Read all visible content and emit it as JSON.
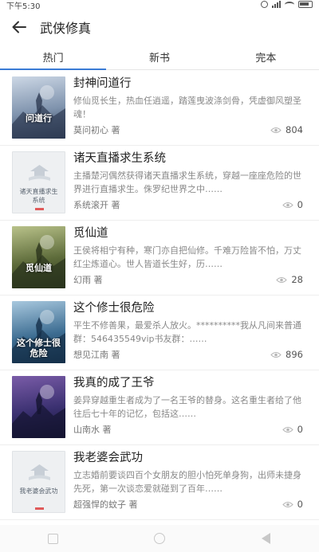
{
  "status_bar": {
    "time": "下午5:30"
  },
  "header": {
    "title": "武侠修真"
  },
  "tabs": [
    {
      "label": "热门",
      "active": true
    },
    {
      "label": "新书",
      "active": false
    },
    {
      "label": "完本",
      "active": false
    }
  ],
  "books": [
    {
      "title": "封神问道行",
      "desc": "修仙觅长生，热血任逍遥，踏莲曳波涤剑骨，凭虚御风塑圣魂！",
      "author": "莫问初心 著",
      "views": "804",
      "cover": {
        "style": "art",
        "text": "问道行",
        "colors": [
          "#cdd8e6",
          "#7f93ad",
          "#2e3b52"
        ]
      }
    },
    {
      "title": "诸天直播求生系统",
      "desc": "主播楚河偶然获得诸天直播求生系统，穿越一座座危险的世界进行直播求生。侏罗纪世界之中……",
      "author": "系统滚开 著",
      "views": "0",
      "cover": {
        "style": "default",
        "text": "诸天直播求生系统"
      }
    },
    {
      "title": "觅仙道",
      "desc": "王侯将相宁有种，寒门亦自把仙修。千难万险皆不怕，万丈红尘炼道心。世人皆道长生好，历……",
      "author": "幻雨 著",
      "views": "28",
      "cover": {
        "style": "art",
        "text": "觅仙道",
        "colors": [
          "#b9c28a",
          "#5d6b3a",
          "#2a331c"
        ]
      }
    },
    {
      "title": "这个修士很危险",
      "desc": "平生不修善果，最爱杀人放火。**********我从凡间来普通群：546435549vip书友群：……",
      "author": "想见江南 著",
      "views": "896",
      "cover": {
        "style": "art",
        "text": "这个修士很危险",
        "colors": [
          "#a8c8de",
          "#3d6d92",
          "#15304a"
        ]
      }
    },
    {
      "title": "我真的成了王爷",
      "desc": "姜异穿越重生者成为了一名王爷的替身。这名重生者给了他往后七十年的记忆，包括这……",
      "author": "山南水 著",
      "views": "0",
      "cover": {
        "style": "art",
        "text": "",
        "colors": [
          "#7a5ca8",
          "#3a3070",
          "#141430"
        ]
      }
    },
    {
      "title": "我老婆会武功",
      "desc": "立志婚前要谈四百个女朋友的胆小怕死单身狗，出师未捷身先死，第一次谈恋爱就碰到了百年……",
      "author": "超强悍的蚊子 著",
      "views": "0",
      "cover": {
        "style": "default",
        "text": "我老婆会武功"
      }
    }
  ]
}
